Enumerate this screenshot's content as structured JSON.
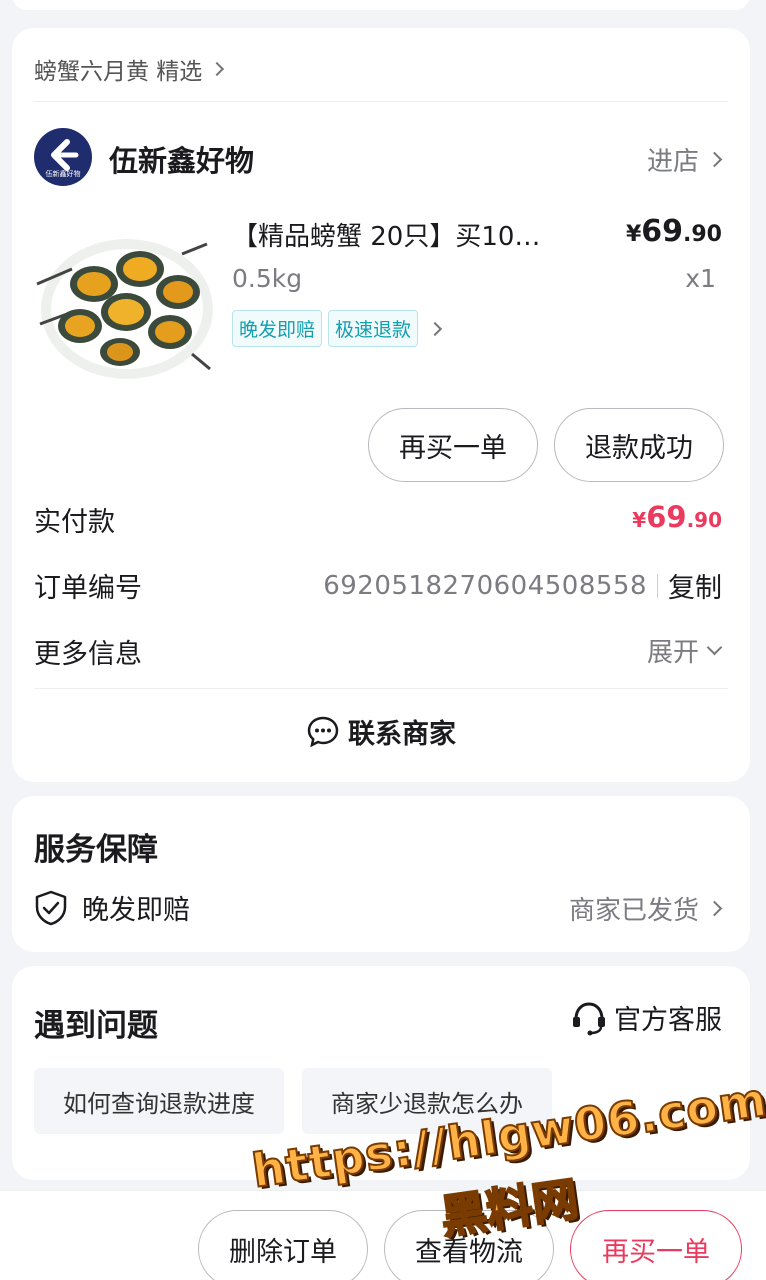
{
  "breadcrumb": {
    "text": "螃蟹六月黄 精选"
  },
  "shop": {
    "name": "伍新鑫好物",
    "logo_text": "伍新鑫好物",
    "enter_label": "进店"
  },
  "product": {
    "title": "【精品螃蟹 20只】买10…",
    "spec": "0.5kg",
    "price_symbol": "¥",
    "price_int": "69",
    "price_dec": ".90",
    "quantity": "x1",
    "tags": [
      "晚发即赔",
      "极速退款"
    ],
    "image_icon": "crab-image"
  },
  "order_actions": {
    "rebuy": "再买一单",
    "refund_status": "退款成功"
  },
  "order_info": {
    "paid_label": "实付款",
    "paid_symbol": "¥",
    "paid_int": "69",
    "paid_dec": ".90",
    "order_no_label": "订单编号",
    "order_no": "6920518270604508558",
    "copy_label": "复制",
    "more_label": "更多信息",
    "expand_label": "展开"
  },
  "contact": {
    "label": "联系商家",
    "icon": "chat-bubble-icon"
  },
  "service": {
    "title": "服务保障",
    "item_label": "晚发即赔",
    "item_status": "商家已发货",
    "icon": "shield-check-icon"
  },
  "problems": {
    "title": "遇到问题",
    "customer_service": "官方客服",
    "questions": [
      "如何查询退款进度",
      "商家少退款怎么办"
    ]
  },
  "bottom_bar": {
    "delete": "删除订单",
    "logistics": "查看物流",
    "rebuy": "再买一单"
  },
  "watermark": {
    "url": "https://hlgw06.com",
    "name": "黑料网"
  },
  "colors": {
    "accent_red": "#ea3b5e",
    "tag_teal": "#139fb0",
    "logo_navy": "#1f2d6e"
  }
}
